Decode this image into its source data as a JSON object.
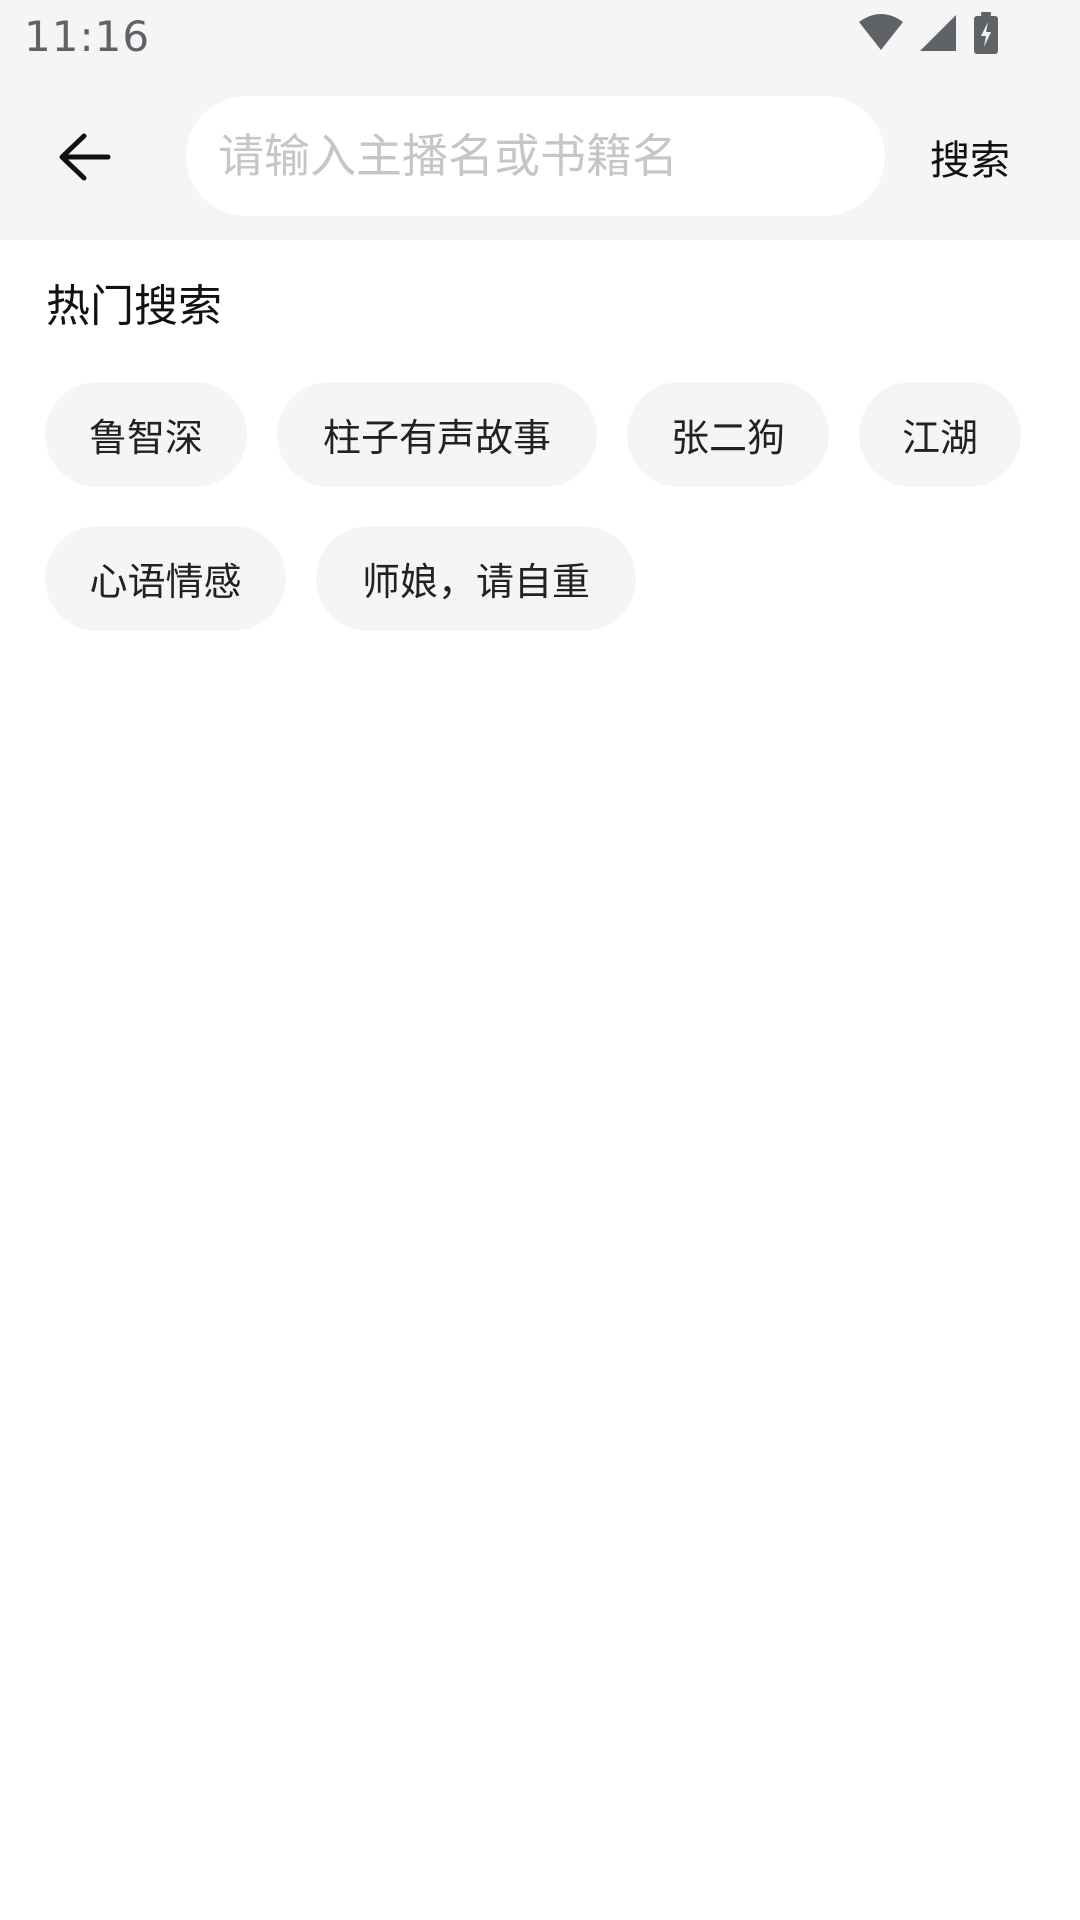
{
  "status_bar": {
    "time": "11:16",
    "icons": [
      "wifi-icon",
      "signal-icon",
      "battery-charging-icon"
    ]
  },
  "header": {
    "back_icon": "arrow-left-icon",
    "search_placeholder": "请输入主播名或书籍名",
    "search_value": "",
    "search_button_label": "搜索"
  },
  "hot_search": {
    "title": "热门搜索",
    "tags": [
      "鲁智深",
      "柱子有声故事",
      "张二狗",
      "江湖",
      "心语情感",
      "师娘，请自重"
    ]
  },
  "colors": {
    "header_bg": "#f5f5f5",
    "tag_bg": "#f5f5f5",
    "placeholder": "#c6c6c6"
  }
}
